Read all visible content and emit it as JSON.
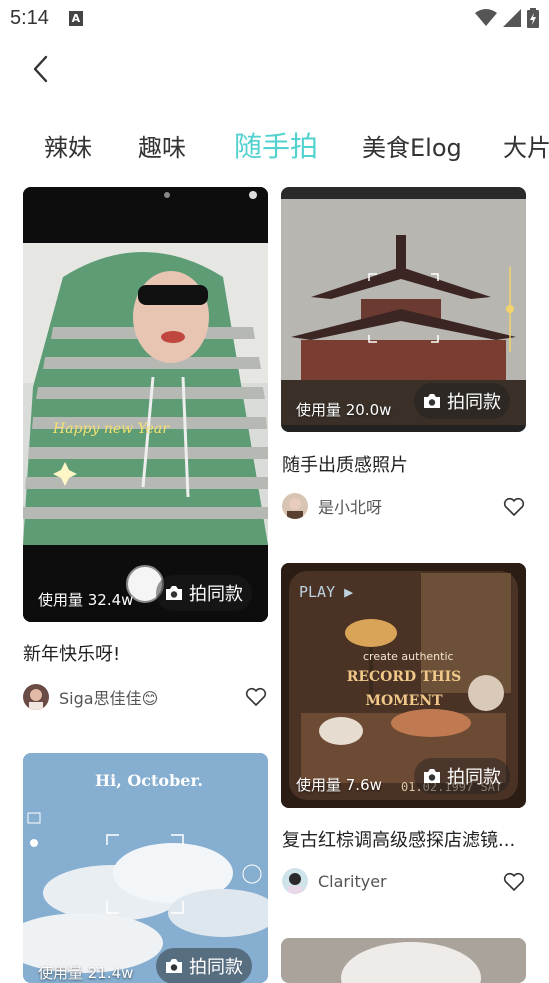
{
  "status_bar": {
    "time": "5:14",
    "notification_badge": "A"
  },
  "tabs": [
    {
      "label": "辣妹",
      "active": false
    },
    {
      "label": "趣味",
      "active": false
    },
    {
      "label": "随手拍",
      "active": true
    },
    {
      "label": "美食Elog",
      "active": false
    },
    {
      "label": "大片",
      "active": false
    }
  ],
  "accent_color": "#52d2cf",
  "posts": [
    {
      "usage": "使用量 32.4w",
      "shoot_label": "拍同款",
      "title": "新年快乐呀!",
      "author": "Siga思佳佳😊",
      "overlay_text": "Happy new Year"
    },
    {
      "usage": "使用量 20.0w",
      "shoot_label": "拍同款",
      "title": "随手出质感照片",
      "author": "是小北呀"
    },
    {
      "usage": "使用量 7.6w",
      "shoot_label": "拍同款",
      "title": "复古红棕调高级感探店滤镜...",
      "author": "Clarityer",
      "overlay_text": "RECORD THIS MOMENT",
      "overlay_sub": "create authentic",
      "date_stamp": "01.02.1997 SAT",
      "play_text": "PLAY ▶"
    },
    {
      "usage": "使用量 21.4w",
      "shoot_label": "拍同款",
      "overlay_text": "Hi, October."
    }
  ]
}
